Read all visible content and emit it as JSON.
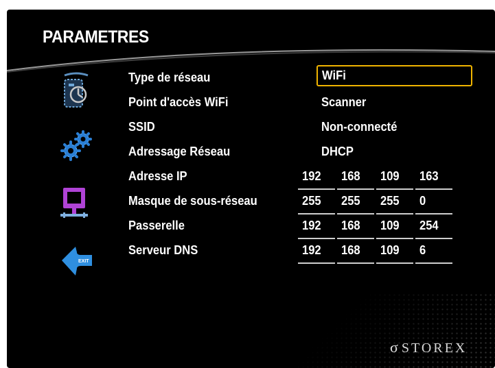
{
  "header": {
    "title": "PARAMETRES"
  },
  "sidebar": {
    "icons": [
      {
        "name": "network-type-icon"
      },
      {
        "name": "settings-gears-icon"
      },
      {
        "name": "network-monitor-icon"
      },
      {
        "name": "exit-arrow-icon",
        "label": "EXIT"
      }
    ]
  },
  "rows": [
    {
      "label": "Type de réseau",
      "value": "WiFi"
    },
    {
      "label": "Point d'accès WiFi",
      "value": "Scanner"
    },
    {
      "label": "SSID",
      "value": "Non-connecté"
    },
    {
      "label": "Adressage Réseau",
      "value": "DHCP"
    },
    {
      "label": "Adresse IP",
      "octets": [
        "192",
        "168",
        "109",
        "163"
      ]
    },
    {
      "label": "Masque de sous-réseau",
      "octets": [
        "255",
        "255",
        "255",
        "0"
      ]
    },
    {
      "label": "Passerelle",
      "octets": [
        "192",
        "168",
        "109",
        "254"
      ]
    },
    {
      "label": "Serveur DNS",
      "octets": [
        "192",
        "168",
        "109",
        "6"
      ]
    }
  ],
  "brand": {
    "name": "STOREX"
  },
  "colors": {
    "focus": "#f0b400",
    "icon_purple": "#b043d6",
    "icon_blue": "#3a9de0"
  }
}
